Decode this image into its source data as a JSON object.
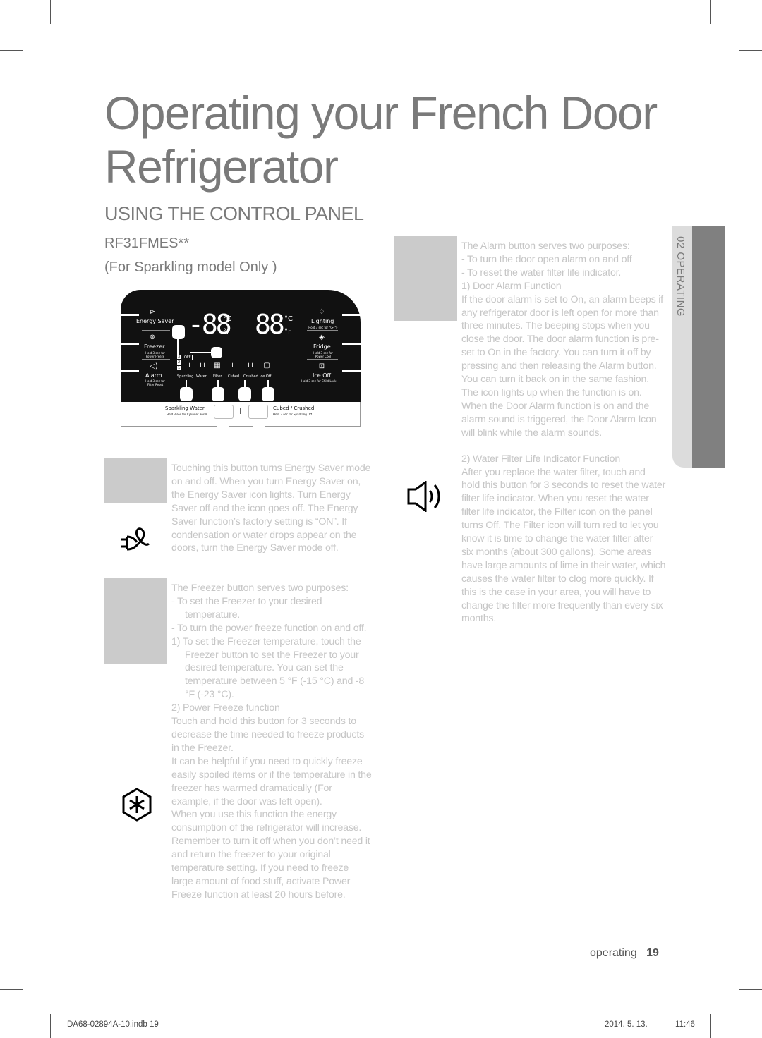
{
  "page": {
    "title": "Operating your French Door Refrigerator",
    "section_heading": "USING THE CONTROL PANEL",
    "model": "RF31FMES**",
    "model_note": "(For Sparkling model Only )",
    "side_tab": "02  OPERATING",
    "footer": {
      "prefix": "operating _",
      "page_number": "19"
    },
    "slug": {
      "file": "DA68-02894A-10.indb   19",
      "date": "2014. 5. 13.",
      "time": "11:46"
    }
  },
  "control_panel": {
    "left_buttons": [
      {
        "label": "Energy Saver",
        "hint": "",
        "icon": "energy-saver-plug-icon"
      },
      {
        "label": "Freezer",
        "hint": "Hold 3 sec for Power Freeze",
        "icon": "freezer-snowflake-icon"
      },
      {
        "label": "Alarm",
        "hint": "Hold 3 sec for Filter Reset",
        "icon": "alarm-speaker-icon"
      }
    ],
    "right_buttons": [
      {
        "label": "Lighting",
        "hint": "Hold 3 sec for °C↔°F",
        "icon": "lighting-bulb-icon"
      },
      {
        "label": "Fridge",
        "hint": "Hold 3 sec for Power Cool",
        "icon": "fridge-drop-icon"
      },
      {
        "label": "Ice Off",
        "hint": "Hold 3 sec for Child Lock",
        "icon": "lock-icon"
      }
    ],
    "freezer_display": "-88",
    "fridge_display": "88",
    "unit_c": "°C",
    "unit_f": "°F",
    "levels": [
      "3",
      "2",
      "1"
    ],
    "off_badge": "OFF",
    "dispenser_icons": [
      {
        "label": "Sparkling",
        "icon": "sparkling-cup-icon"
      },
      {
        "label": "Water",
        "icon": "water-cup-icon"
      },
      {
        "label": "Filter",
        "icon": "filter-icon"
      },
      {
        "label": "Cubed",
        "icon": "cubed-ice-icon"
      },
      {
        "label": "Crushed",
        "icon": "crushed-ice-icon"
      },
      {
        "label": "Ice Off",
        "icon": "ice-off-icon"
      }
    ],
    "bottom_left": {
      "label": "Sparkling Water",
      "hint": "Hold 3 sec for Cylinder Reset"
    },
    "bottom_right": {
      "label": "Cubed / Crushed",
      "hint": "Hold 3 sec for Sparkling Off"
    },
    "divider": "|"
  },
  "energy_saver_text": "Touching this button turns Energy Saver mode on and off. When you turn Energy Saver on, the Energy Saver icon lights. Turn Energy Saver off and the icon goes off. The Energy Saver function’s factory setting is “ON”. If condensation or water drops appear on the doors, turn the Energy Saver mode off.",
  "freezer_text": {
    "intro": "The Freezer button serves two purposes:",
    "bullets": [
      "-   To set the Freezer to your desired temperature.",
      "-   To turn the power freeze function on and off."
    ],
    "item1": "1)  To set the Freezer temperature, touch the Freezer button to set the Freezer to your desired temperature. You can set the temperature between 5 °F (-15 °C) and -8 °F (-23 °C).",
    "item2_title": "2)  Power Freeze function",
    "item2_p1": "Touch and hold this button for 3 seconds to decrease the time needed to freeze products in the Freezer.",
    "item2_p2": "It can be helpful if you need to quickly freeze easily spoiled items or if the temperature in the freezer has warmed dramatically (For example, if the door was left open).",
    "item2_p3": "When you use this function the energy consumption of the refrigerator will increase. Remember to turn it off when you don’t need it and return the freezer to your original temperature setting. If you need to freeze large amount of food stuff, activate Power Freeze function at least 20 hours before."
  },
  "alarm_text": {
    "intro": "The Alarm button serves two purposes:",
    "bullets": [
      "-   To turn the door open alarm on and off",
      "-   To reset the water filter life indicator."
    ],
    "item1_title": "1)  Door Alarm Function",
    "item1_body": "If the door alarm is set to On, an alarm beeps if any refrigerator door is left open for more than three minutes. The beeping stops when you close the door. The door alarm function is pre-set to On in the factory. You can turn it off by pressing and then releasing the Alarm button. You can turn it back on in the same fashion. The icon lights up when the function is on. When the Door Alarm function is on and the alarm sound is triggered, the Door Alarm Icon will blink while the alarm sounds.",
    "item2_title": "2)  Water Filter Life Indicator Function",
    "item2_body": "After you replace the water filter, touch and hold this button for 3 seconds to reset the water filter life indicator. When you reset the water filter life indicator, the Filter icon on the panel turns Off. The Filter icon will turn red to let you know it is time to change the water filter after six months (about 300 gallons). Some areas have large amounts of lime in their water, which causes the water filter to clog more quickly. If this is the case in your area, you will have to change the filter more frequently than every six months."
  }
}
